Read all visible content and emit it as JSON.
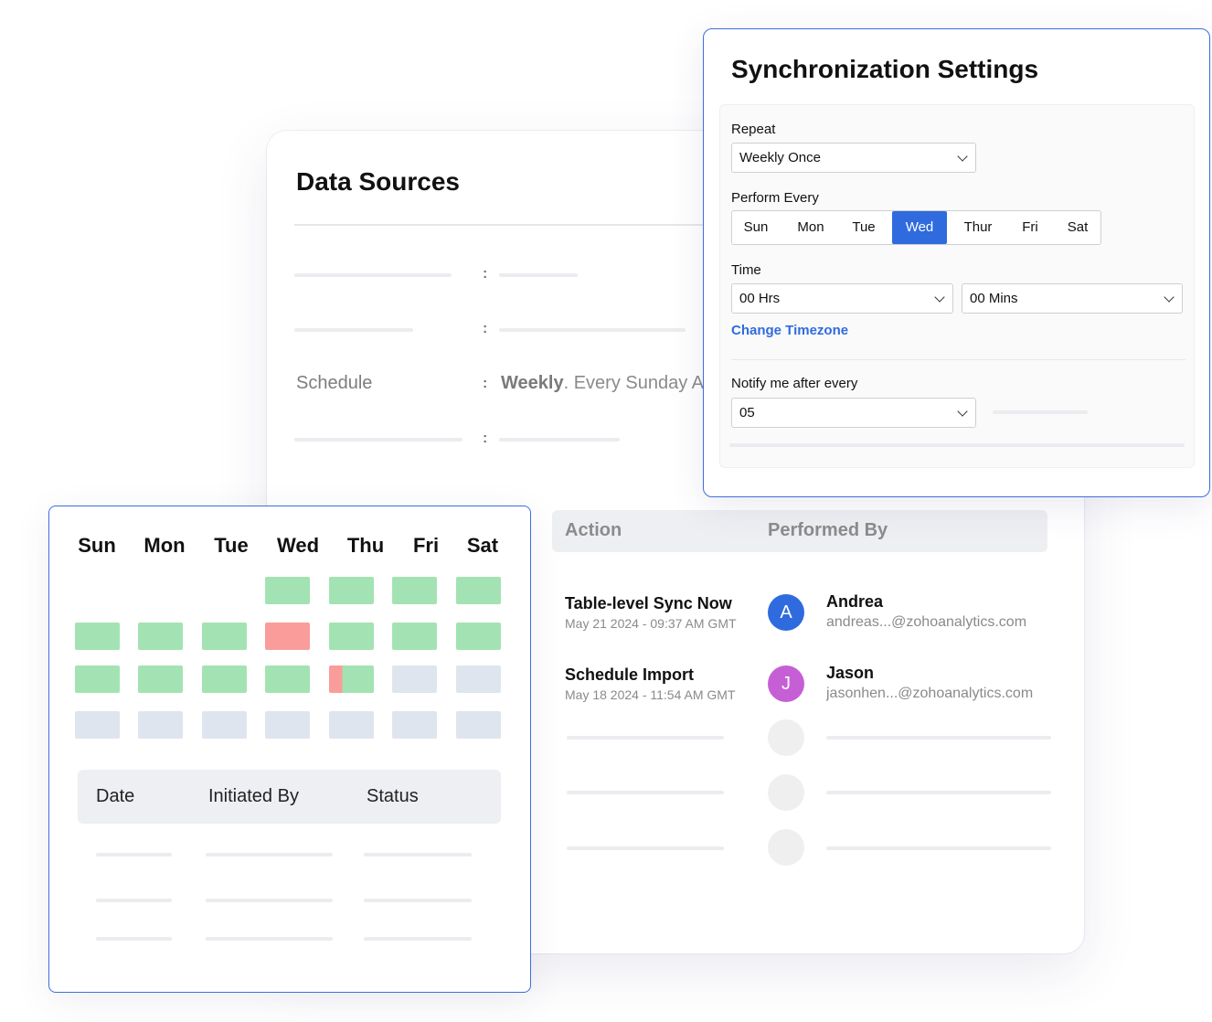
{
  "data_sources": {
    "title": "Data Sources",
    "schedule_label": "Schedule",
    "schedule_colon": ":",
    "schedule_value_bold": "Weekly",
    "schedule_value_rest": ". Every Sunday A"
  },
  "activity": {
    "headers": {
      "action": "Action",
      "performed_by": "Performed By"
    },
    "rows": [
      {
        "title": "Table-level Sync Now",
        "date": "May 21 2024 -  09:37 AM GMT",
        "avatar_letter": "A",
        "avatar_color": "#2f6bdf",
        "name": "Andrea",
        "email": "andreas...@zohoanalytics.com"
      },
      {
        "title": "Schedule Import",
        "date": "May 18 2024 - 11:54 AM GMT",
        "avatar_letter": "J",
        "avatar_color": "#c65fd6",
        "name": "Jason",
        "email": "jasonhen...@zohoanalytics.com"
      }
    ]
  },
  "sync_settings": {
    "title": "Synchronization Settings",
    "repeat_label": "Repeat",
    "repeat_value": "Weekly Once",
    "perform_every_label": "Perform Every",
    "days": [
      "Sun",
      "Mon",
      "Tue",
      "Wed",
      "Thur",
      "Fri",
      "Sat"
    ],
    "selected_day": "Wed",
    "time_label": "Time",
    "hours_value": "00 Hrs",
    "mins_value": "00 Mins",
    "change_timezone": "Change Timezone",
    "notify_label": "Notify me after every",
    "notify_value": "05",
    "accent_color": "#2f6bdf"
  },
  "calendar": {
    "days": [
      "Sun",
      "Mon",
      "Tue",
      "Wed",
      "Thu",
      "Fri",
      "Sat"
    ],
    "weeks": [
      [
        "none",
        "none",
        "none",
        "success",
        "success",
        "success",
        "success"
      ],
      [
        "success",
        "success",
        "success",
        "failed",
        "success",
        "success",
        "success"
      ],
      [
        "success",
        "success",
        "success",
        "success",
        "partial",
        "empty",
        "empty"
      ],
      [
        "empty",
        "empty",
        "empty",
        "empty",
        "empty",
        "empty",
        "empty"
      ]
    ],
    "status_colors": {
      "success": "#a3e3b3",
      "failed": "#fa9d9a",
      "empty": "#dfe5ee"
    },
    "log_headers": {
      "date": "Date",
      "initiated_by": "Initiated By",
      "status": "Status"
    }
  }
}
